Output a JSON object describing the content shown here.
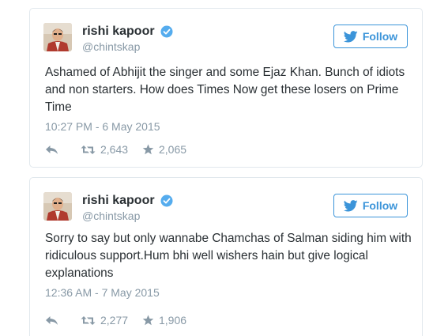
{
  "colors": {
    "accent": "#3b94d9",
    "verified": "#55acee",
    "text": "#292f33",
    "muted": "#8899a6",
    "border": "#e1e8ed"
  },
  "tweets": [
    {
      "display_name": "rishi kapoor",
      "handle": "@chintskap",
      "follow_label": "Follow",
      "text": "Ashamed of Abhijit the singer and some Ejaz Khan. Bunch of idiots and non starters. How does Times Now get these losers on Prime Time",
      "timestamp": "10:27 PM - 6 May 2015",
      "retweets": "2,643",
      "favorites": "2,065",
      "icons": [
        "avatar",
        "verified-badge-icon",
        "twitter-bird-icon",
        "reply-icon",
        "retweet-icon",
        "favorite-star-icon"
      ]
    },
    {
      "display_name": "rishi kapoor",
      "handle": "@chintskap",
      "follow_label": "Follow",
      "text": "Sorry to say but only wannabe Chamchas of Salman siding him with ridiculous support.Hum bhi well wishers hain  but give logical explanations",
      "timestamp": "12:36 AM - 7 May 2015",
      "retweets": "2,277",
      "favorites": "1,906",
      "icons": [
        "avatar",
        "verified-badge-icon",
        "twitter-bird-icon",
        "reply-icon",
        "retweet-icon",
        "favorite-star-icon"
      ]
    }
  ]
}
